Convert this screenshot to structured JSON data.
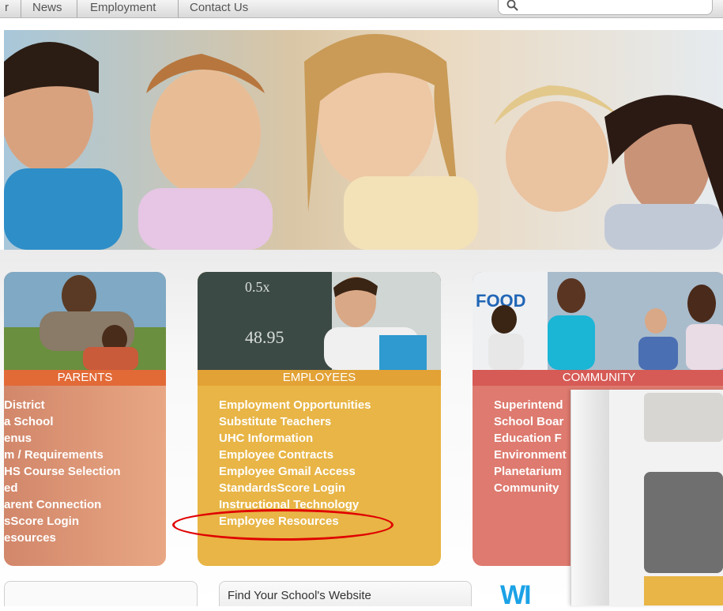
{
  "nav": {
    "partial_left": "r",
    "items": [
      "News",
      "Employment",
      "Contact Us"
    ]
  },
  "search": {
    "icon": "search-icon"
  },
  "cards": {
    "parents": {
      "title": "PARENTS",
      "links": [
        "District",
        "a School",
        "enus",
        "m / Requirements",
        "HS Course Selection",
        "ed",
        "arent Connection",
        "sScore Login",
        "esources"
      ]
    },
    "employees": {
      "title": "EMPLOYEES",
      "links": [
        "Employment Opportunities",
        "Substitute Teachers",
        "UHC Information",
        "Employee Contracts",
        "Employee Gmail Access",
        "StandardsScore Login",
        "Instructional Technology",
        "Employee Resources"
      ]
    },
    "community": {
      "title": "COMMUNITY",
      "links": [
        "Superintend",
        "School Boar",
        "Education F",
        "Environment",
        "Planetarium",
        "Community"
      ],
      "photo_sign": "FOOD"
    }
  },
  "bottom": {
    "find_label": "Find Your School's Website",
    "logo_partial": "WI"
  },
  "colors": {
    "parents": "#e26a37",
    "employees": "#e8b546",
    "community": "#d65a55",
    "highlight": "#e00000"
  }
}
